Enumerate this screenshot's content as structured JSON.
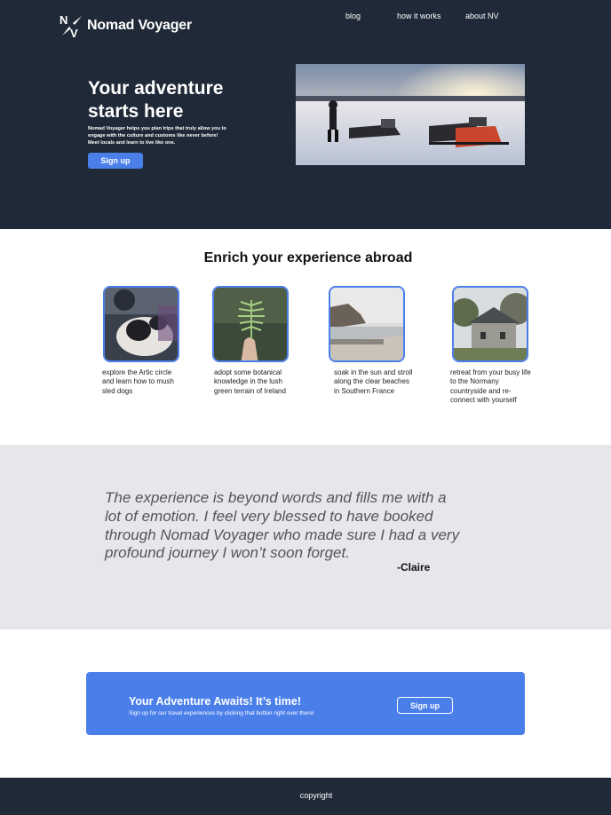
{
  "brand": {
    "name": "Nomad Voyager",
    "logo_icon": "nv-compass-logo-icon"
  },
  "nav": {
    "items": [
      {
        "label": "blog"
      },
      {
        "label": "how it works"
      },
      {
        "label": "about NV"
      }
    ]
  },
  "hero": {
    "title": "Your adventure starts here",
    "description": "Nomad Voyager helps you plan trips that truly allow you to engage with the culture and customs like never before! Meet locals and learn to live like one.",
    "button_label": "Sign up",
    "image": "snowmobiles-on-frozen-lake-photo"
  },
  "features": {
    "title": "Enrich your experience abroad",
    "cards": [
      {
        "image": "sled-dog-with-musher-photo",
        "text": "explore the Artic circle and learn how to mush sled dogs"
      },
      {
        "image": "hand-holding-fern-photo",
        "text": "adopt some botanical knowledge in the lush green terrain of Ireland"
      },
      {
        "image": "coastal-beach-promenade-photo",
        "text": "soak in the sun and stroll along the clear beaches in Southern France"
      },
      {
        "image": "countryside-stone-house-photo",
        "text": "retreat from your busy life to the Normany countryside and re-connect with yourself"
      }
    ]
  },
  "testimonial": {
    "quote": "The experience is beyond words and fills me with a lot of emotion. I feel very blessed to have booked through Nomad Voyager who made sure I had a very profound journey I won’t soon forget.",
    "author": "-Claire"
  },
  "cta": {
    "title": "Your Adventure Awaits! It’s time!",
    "subtitle": "Sign up for our travel experiences by clicking that button right over there!",
    "button_label": "Sign up"
  },
  "footer": {
    "text": "copyright"
  },
  "colors": {
    "dark_navy": "#1f2937",
    "accent_blue": "#4a7fea",
    "light_gray": "#e5e7eb"
  }
}
